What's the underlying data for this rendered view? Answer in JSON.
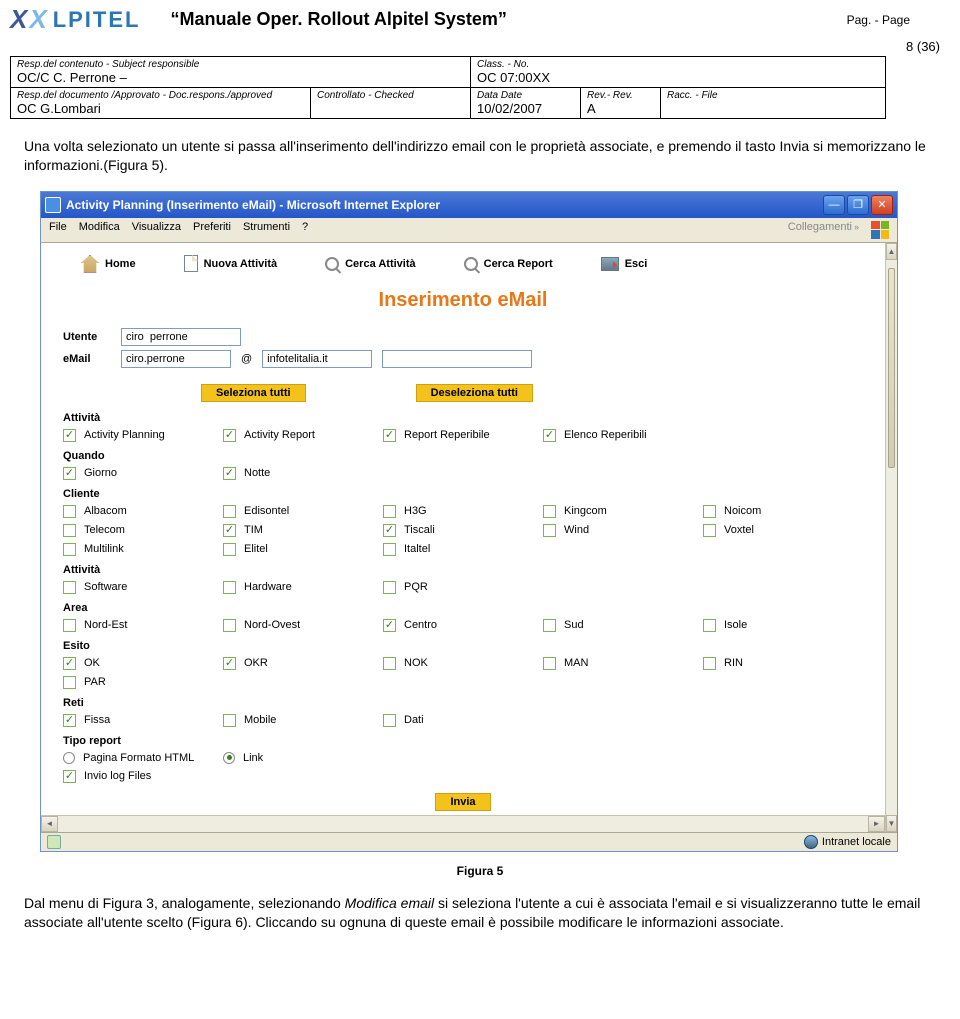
{
  "header": {
    "logo_text": "LPITEL",
    "quote_open": "“",
    "doc_title": "Manuale  Oper.  Rollout  Alpitel System",
    "quote_close": "”",
    "pag_label": "Pag. - Page",
    "page_num": "8 (36)"
  },
  "info": {
    "r1c1_lbl": "Resp.del contenuto - Subject responsible",
    "r1c1_val": "OC/C C. Perrone –",
    "r1c2_lbl": "Class. - No.",
    "r1c2_val": "OC 07:00XX",
    "r2c1_lbl": "Resp.del documento /Approvato - Doc.respons./approved",
    "r2c1_val": "OC G.Lombari",
    "r2c2_lbl": "Controllato - Checked",
    "r2c3_lbl": "Data Date",
    "r2c3_val": "10/02/2007",
    "r2c4_lbl": "Rev.- Rev.",
    "r2c4_val": "A",
    "r2c5_lbl": "Racc. - File"
  },
  "para1": "Una volta selezionato un utente si passa all'inserimento dell'indirizzo email con le proprietà associate,  e premendo il tasto Invia si memorizzano le informazioni.(Figura 5).",
  "browser": {
    "title": "Activity Planning (Inserimento eMail) - Microsoft Internet Explorer",
    "menu": {
      "file": "File",
      "modifica": "Modifica",
      "visualizza": "Visualizza",
      "preferiti": "Preferiti",
      "strumenti": "Strumenti",
      "help": "?",
      "collegamenti": "Collegamenti"
    },
    "nav": {
      "home": "Home",
      "nuova": "Nuova Attività",
      "cerca_a": "Cerca Attività",
      "cerca_r": "Cerca Report",
      "esci": "Esci"
    },
    "page_heading": "Inserimento eMail",
    "form": {
      "utente_lbl": "Utente",
      "utente_val": "ciro  perrone",
      "email_lbl": "eMail",
      "email_user": "ciro.perrone",
      "email_at": "@",
      "email_domain": "infotelitalia.it"
    },
    "btn_sel_all": "Seleziona tutti",
    "btn_desel_all": "Deseleziona tutti",
    "sections": {
      "attivita_lbl": "Attività",
      "attivita": [
        {
          "label": "Activity Planning",
          "on": true
        },
        {
          "label": "Activity Report",
          "on": true
        },
        {
          "label": "Report Reperibile",
          "on": true
        },
        {
          "label": "Elenco Reperibili",
          "on": true
        }
      ],
      "quando_lbl": "Quando",
      "quando": [
        {
          "label": "Giorno",
          "on": true
        },
        {
          "label": "Notte",
          "on": true
        }
      ],
      "cliente_lbl": "Cliente",
      "cliente": [
        {
          "label": "Albacom",
          "on": false
        },
        {
          "label": "Edisontel",
          "on": false
        },
        {
          "label": "H3G",
          "on": false
        },
        {
          "label": "Kingcom",
          "on": false
        },
        {
          "label": "Noicom",
          "on": false
        },
        {
          "label": "Telecom",
          "on": false
        },
        {
          "label": "TIM",
          "on": true
        },
        {
          "label": "Tiscali",
          "on": true
        },
        {
          "label": "Wind",
          "on": false
        },
        {
          "label": "Voxtel",
          "on": false
        },
        {
          "label": "Multilink",
          "on": false
        },
        {
          "label": "Elitel",
          "on": false
        },
        {
          "label": "Italtel",
          "on": false
        }
      ],
      "attivita2_lbl": "Attività",
      "attivita2": [
        {
          "label": "Software",
          "on": false
        },
        {
          "label": "Hardware",
          "on": false
        },
        {
          "label": "PQR",
          "on": false
        }
      ],
      "area_lbl": "Area",
      "area": [
        {
          "label": "Nord-Est",
          "on": false
        },
        {
          "label": "Nord-Ovest",
          "on": false
        },
        {
          "label": "Centro",
          "on": true
        },
        {
          "label": "Sud",
          "on": false
        },
        {
          "label": "Isole",
          "on": false
        }
      ],
      "esito_lbl": "Esito",
      "esito": [
        {
          "label": "OK",
          "on": true
        },
        {
          "label": "OKR",
          "on": true
        },
        {
          "label": "NOK",
          "on": false
        },
        {
          "label": "MAN",
          "on": false
        },
        {
          "label": "RIN",
          "on": false
        },
        {
          "label": "PAR",
          "on": false
        }
      ],
      "reti_lbl": "Reti",
      "reti": [
        {
          "label": "Fissa",
          "on": true
        },
        {
          "label": "Mobile",
          "on": false
        },
        {
          "label": "Dati",
          "on": false
        }
      ],
      "tipo_lbl": "Tipo report",
      "tipo_html": "Pagina Formato HTML",
      "tipo_link": "Link",
      "invio_log": "Invio log Files"
    },
    "btn_invia": "Invia",
    "status_zone": "Intranet locale"
  },
  "fig5": "Figura 5",
  "para2_a": "Dal menu di Figura 3, analogamente, selezionando ",
  "para2_i": "Modifica email",
  "para2_b": "  si seleziona l'utente a cui è associata l'email e si visualizzeranno tutte le email associate all'utente scelto (Figura 6). Cliccando su ognuna di queste email è possibile modificare le informazioni associate."
}
